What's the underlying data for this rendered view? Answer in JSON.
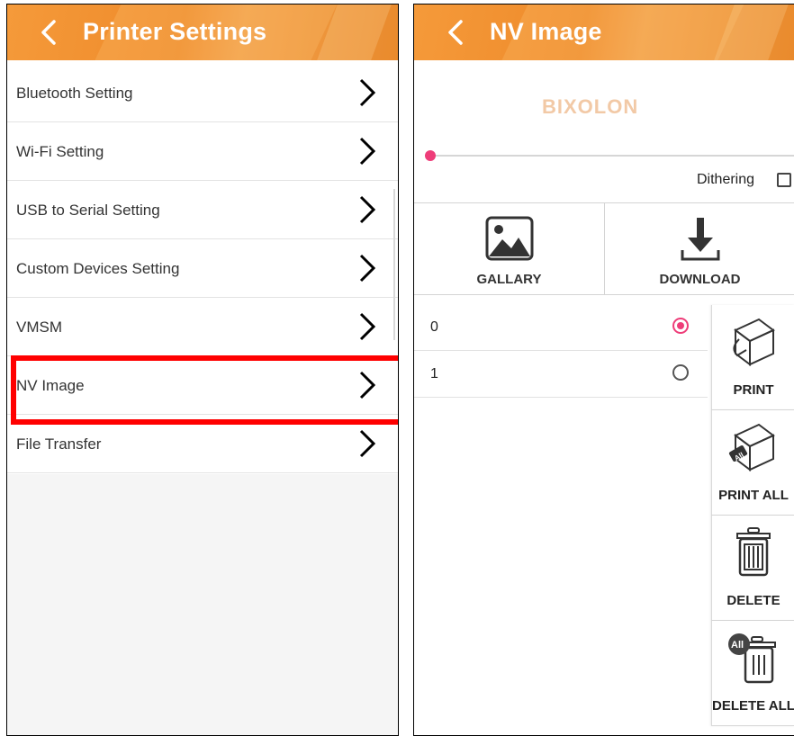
{
  "left": {
    "title": "Printer Settings",
    "items": [
      {
        "label": "Bluetooth Setting"
      },
      {
        "label": "Wi-Fi Setting"
      },
      {
        "label": "USB to Serial Setting"
      },
      {
        "label": "Custom Devices Setting"
      },
      {
        "label": "VMSM"
      },
      {
        "label": "NV Image",
        "highlighted": true
      },
      {
        "label": "File Transfer"
      }
    ]
  },
  "right": {
    "title": "NV Image",
    "logo": "BIXOLON",
    "dithering_label": "Dithering",
    "dithering_checked": false,
    "slider_value": 0,
    "tools": {
      "gallery": "GALLARY",
      "download": "DOWNLOAD"
    },
    "images": [
      {
        "name": "0",
        "selected": true
      },
      {
        "name": "1",
        "selected": false
      }
    ],
    "actions": {
      "print": "PRINT",
      "print_all": "PRINT ALL",
      "delete": "DELETE",
      "delete_all": "DELETE ALL",
      "all_badge": "All"
    }
  },
  "colors": {
    "header": "#ee8a2a",
    "accent": "#ee3d79",
    "highlight": "#ff0000",
    "logo": "#f2c9a6"
  },
  "icons": [
    "back-arrow-icon",
    "chevron-right-icon",
    "image-icon",
    "download-icon",
    "printer-icon",
    "trash-icon"
  ]
}
